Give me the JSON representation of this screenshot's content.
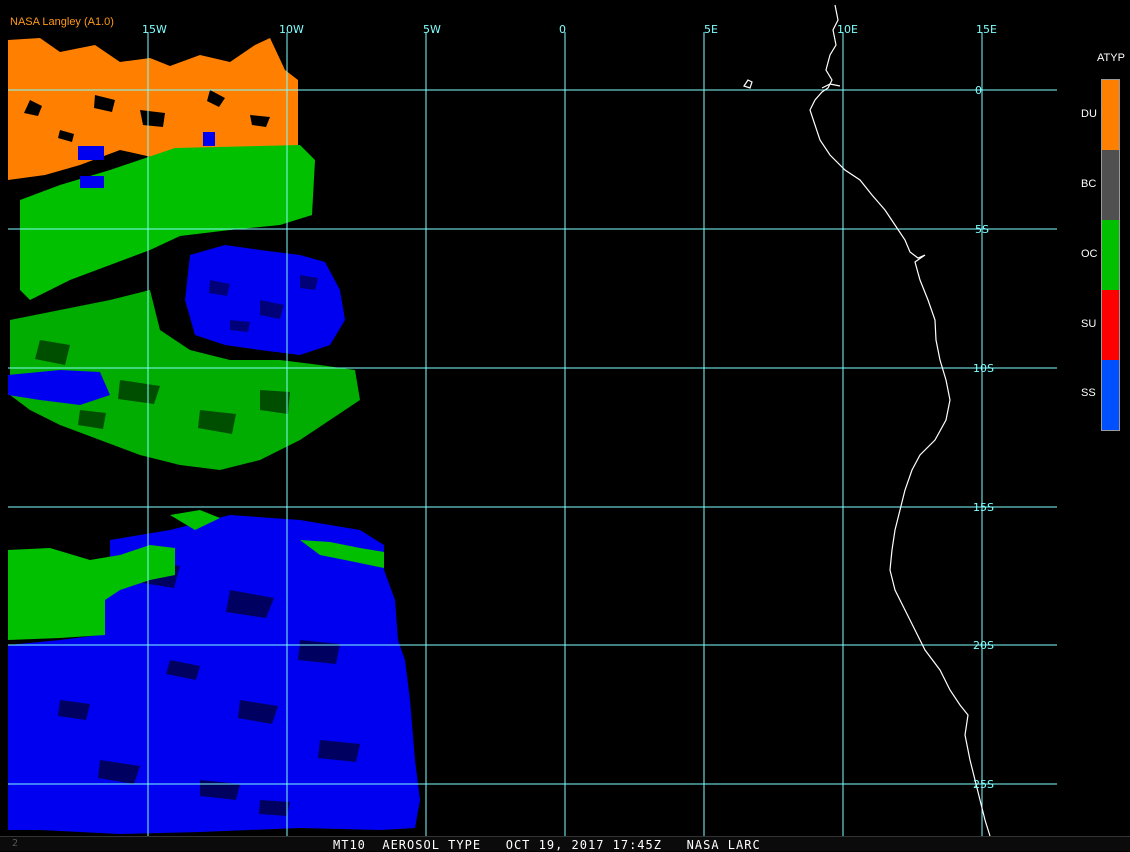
{
  "credit": "NASA Langley (A1.0)",
  "status_bar": {
    "text": "MT10  AEROSOL TYPE   OCT 19, 2017 17:45Z   NASA LARC",
    "frame": "2"
  },
  "lon_labels": [
    "15W",
    "10W",
    "5W",
    "0",
    "5E",
    "10E",
    "15E"
  ],
  "lat_labels": [
    "0",
    "5S",
    "10S",
    "15S",
    "20S",
    "25S"
  ],
  "legend": {
    "title": "ATYP",
    "items": [
      {
        "code": "DU",
        "color": "#ff8000"
      },
      {
        "code": "BC",
        "color": "#505050"
      },
      {
        "code": "OC",
        "color": "#00c000"
      },
      {
        "code": "SU",
        "color": "#ff0000"
      },
      {
        "code": "SS",
        "color": "#0050ff"
      }
    ]
  },
  "colors": {
    "grid": "#7fffff",
    "dust": "#ff8000",
    "organic_carbon": "#00c000",
    "sea_salt": "#0000f0",
    "coast": "#ffffff",
    "background": "#000000"
  }
}
